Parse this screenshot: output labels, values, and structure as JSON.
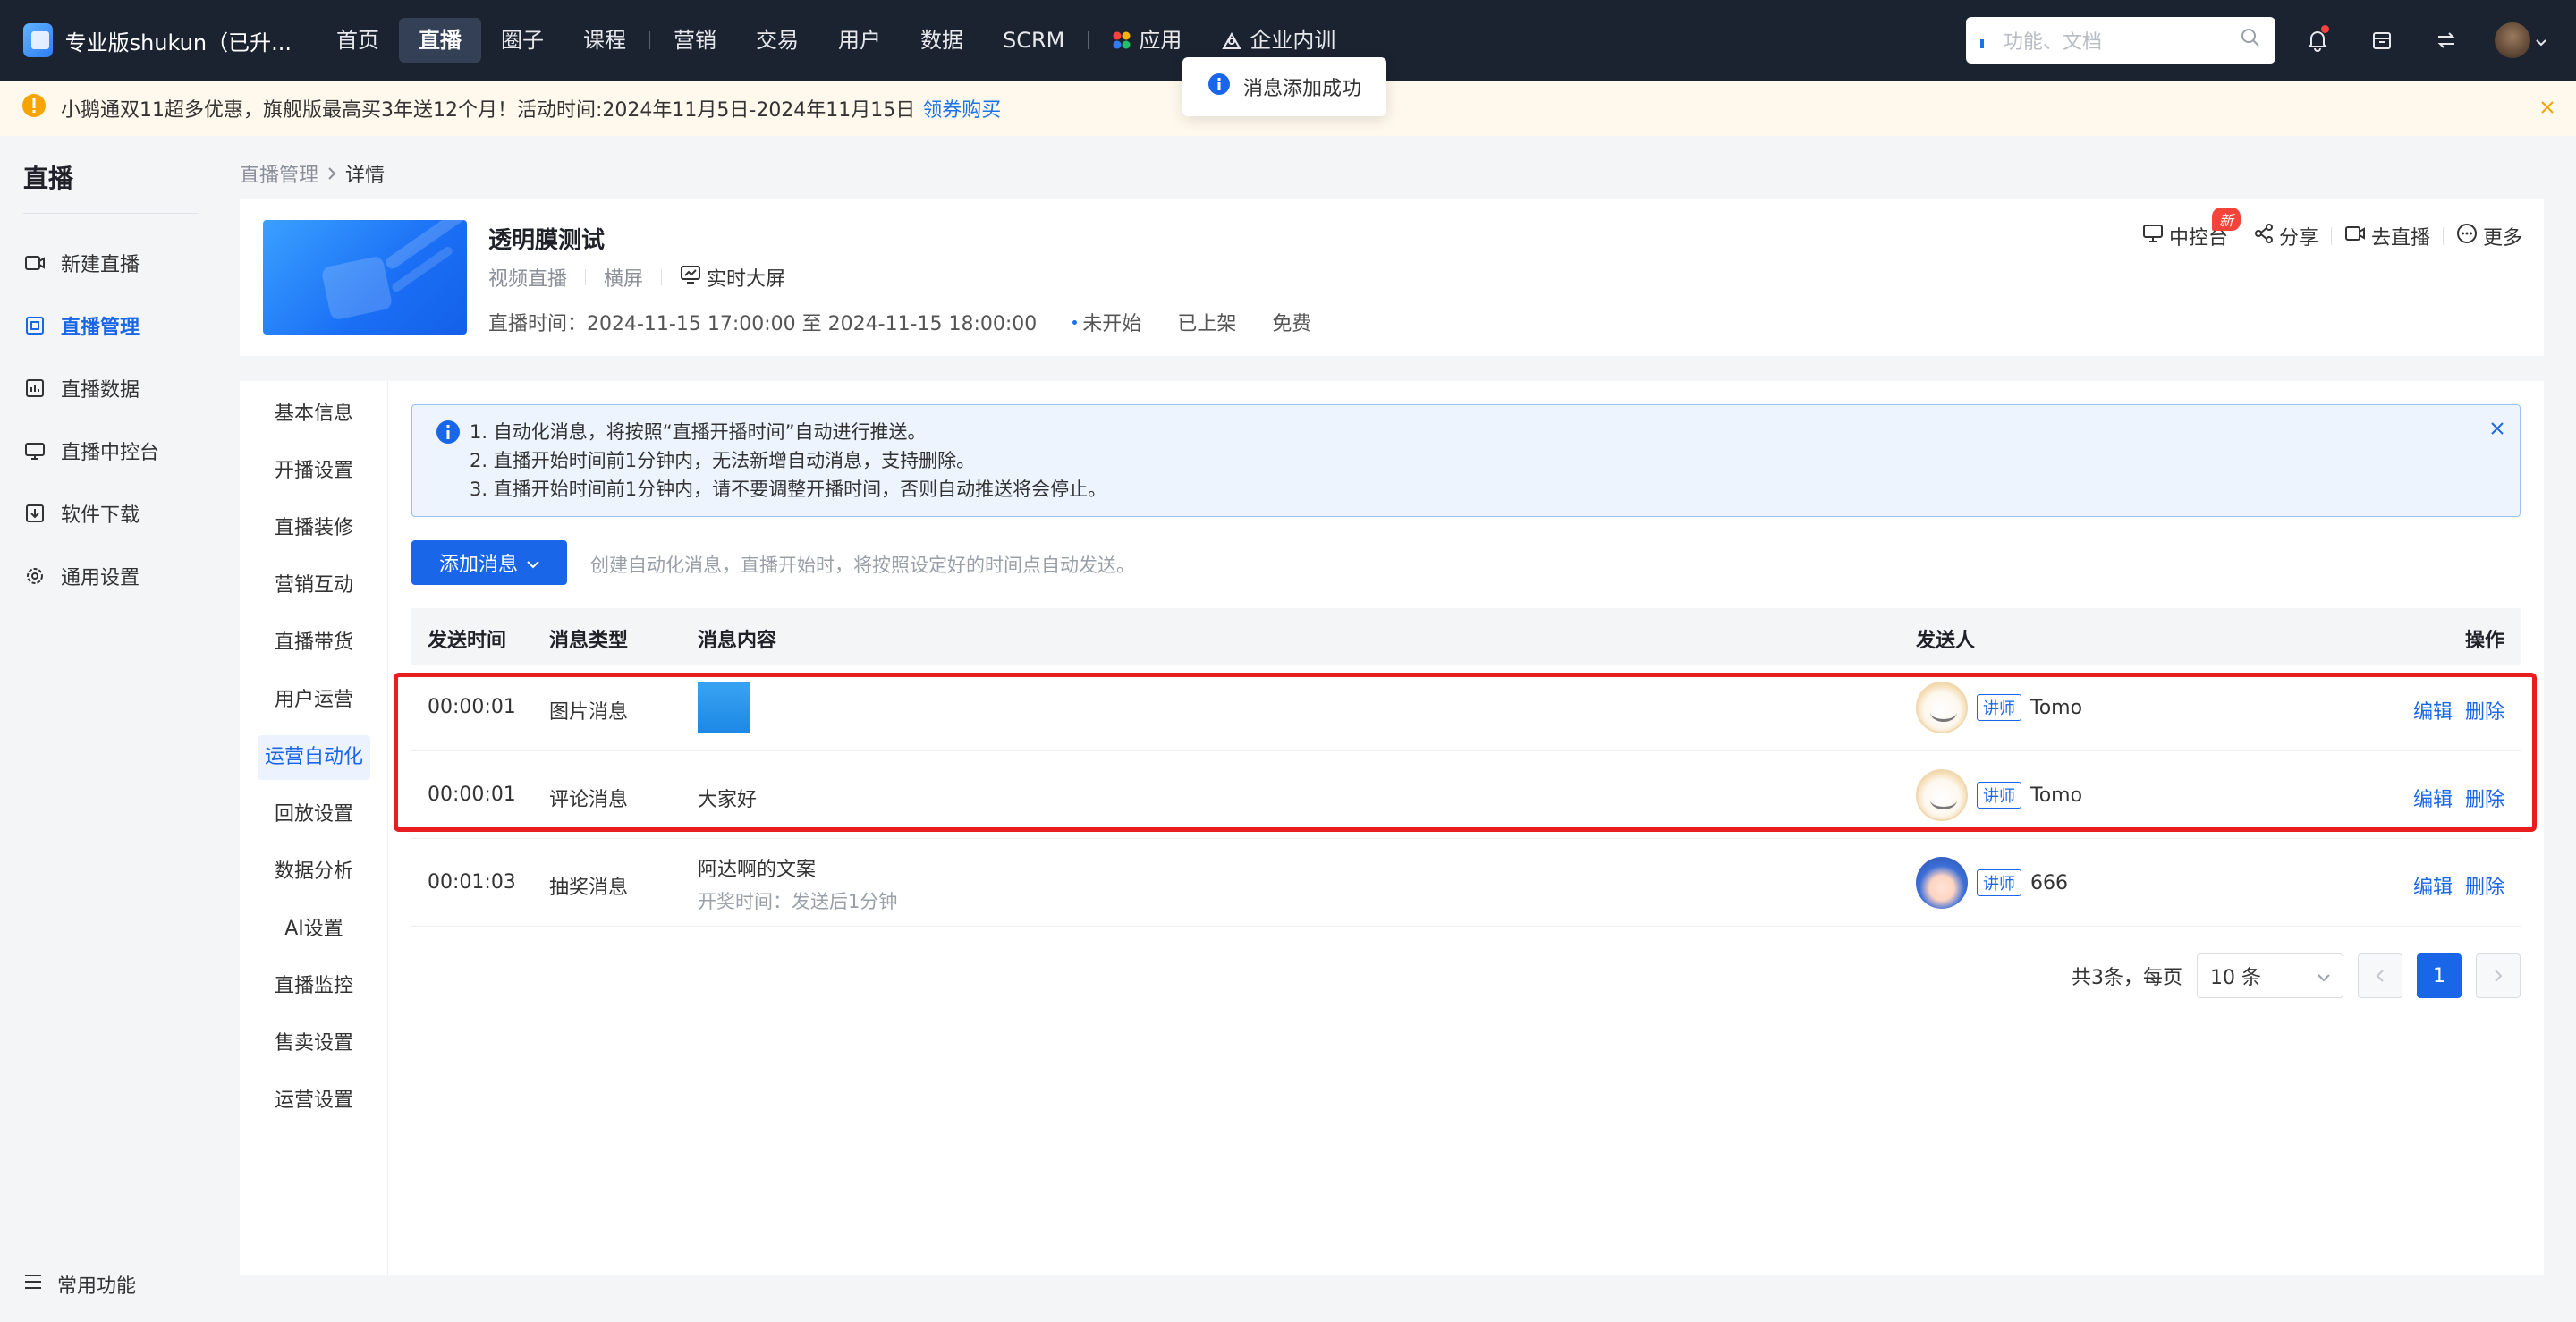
{
  "topbar": {
    "brand": "专业版shukun（已升...",
    "nav": [
      "首页",
      "直播",
      "圈子",
      "课程",
      "营销",
      "交易",
      "用户",
      "数据",
      "SCRM",
      "应用",
      "企业内训"
    ],
    "search_placeholder": "功能、文档"
  },
  "toast": "消息添加成功",
  "notice": {
    "text": "小鹅通双11超多优惠，旗舰版最高买3年送12个月！活动时间:2024年11月5日-2024年11月15日",
    "link": "领券购买"
  },
  "sidebar": {
    "title": "直播",
    "items": [
      "新建直播",
      "直播管理",
      "直播数据",
      "直播中控台",
      "软件下载",
      "通用设置"
    ],
    "footer": "常用功能"
  },
  "breadcrumb": {
    "parent": "直播管理",
    "current": "详情"
  },
  "live": {
    "title": "透明膜测试",
    "type": "视频直播",
    "orientation": "横屏",
    "screen": "实时大屏",
    "time": "直播时间：2024-11-15 17:00:00 至 2024-11-15 18:00:00",
    "status": "未开始",
    "shelf": "已上架",
    "price": "免费",
    "actions": {
      "console": "中控台",
      "new_badge": "新",
      "share": "分享",
      "golive": "去直播",
      "more": "更多"
    }
  },
  "subnav": [
    "基本信息",
    "开播设置",
    "直播装修",
    "营销互动",
    "直播带货",
    "用户运营",
    "运营自动化",
    "回放设置",
    "数据分析",
    "AI设置",
    "直播监控",
    "售卖设置",
    "运营设置"
  ],
  "alert": {
    "lines": [
      "1. 自动化消息，将按照“直播开播时间”自动进行推送。",
      "2. 直播开始时间前1分钟内，无法新增自动消息，支持删除。",
      "3. 直播开始时间前1分钟内，请不要调整开播时间，否则自动推送将会停止。"
    ]
  },
  "add_button": "添加消息",
  "hint": "创建自动化消息，直播开始时，将按照设定好的时间点自动发送。",
  "table": {
    "headers": [
      "发送时间",
      "消息类型",
      "消息内容",
      "发送人",
      "操作"
    ],
    "rows": [
      {
        "time": "00:00:01",
        "type": "图片消息",
        "content": "",
        "sender": "Tomo",
        "role": "讲师",
        "edit": "编辑",
        "del": "删除"
      },
      {
        "time": "00:00:01",
        "type": "评论消息",
        "content": "大家好",
        "sender": "Tomo",
        "role": "讲师",
        "edit": "编辑",
        "del": "删除"
      },
      {
        "time": "00:01:03",
        "type": "抽奖消息",
        "content": "阿达啊的文案",
        "sub": "开奖时间：发送后1分钟",
        "sender": "666",
        "role": "讲师",
        "edit": "编辑",
        "del": "删除"
      }
    ]
  },
  "pager": {
    "total": "共3条，每页",
    "size": "10 条",
    "page": "1"
  }
}
